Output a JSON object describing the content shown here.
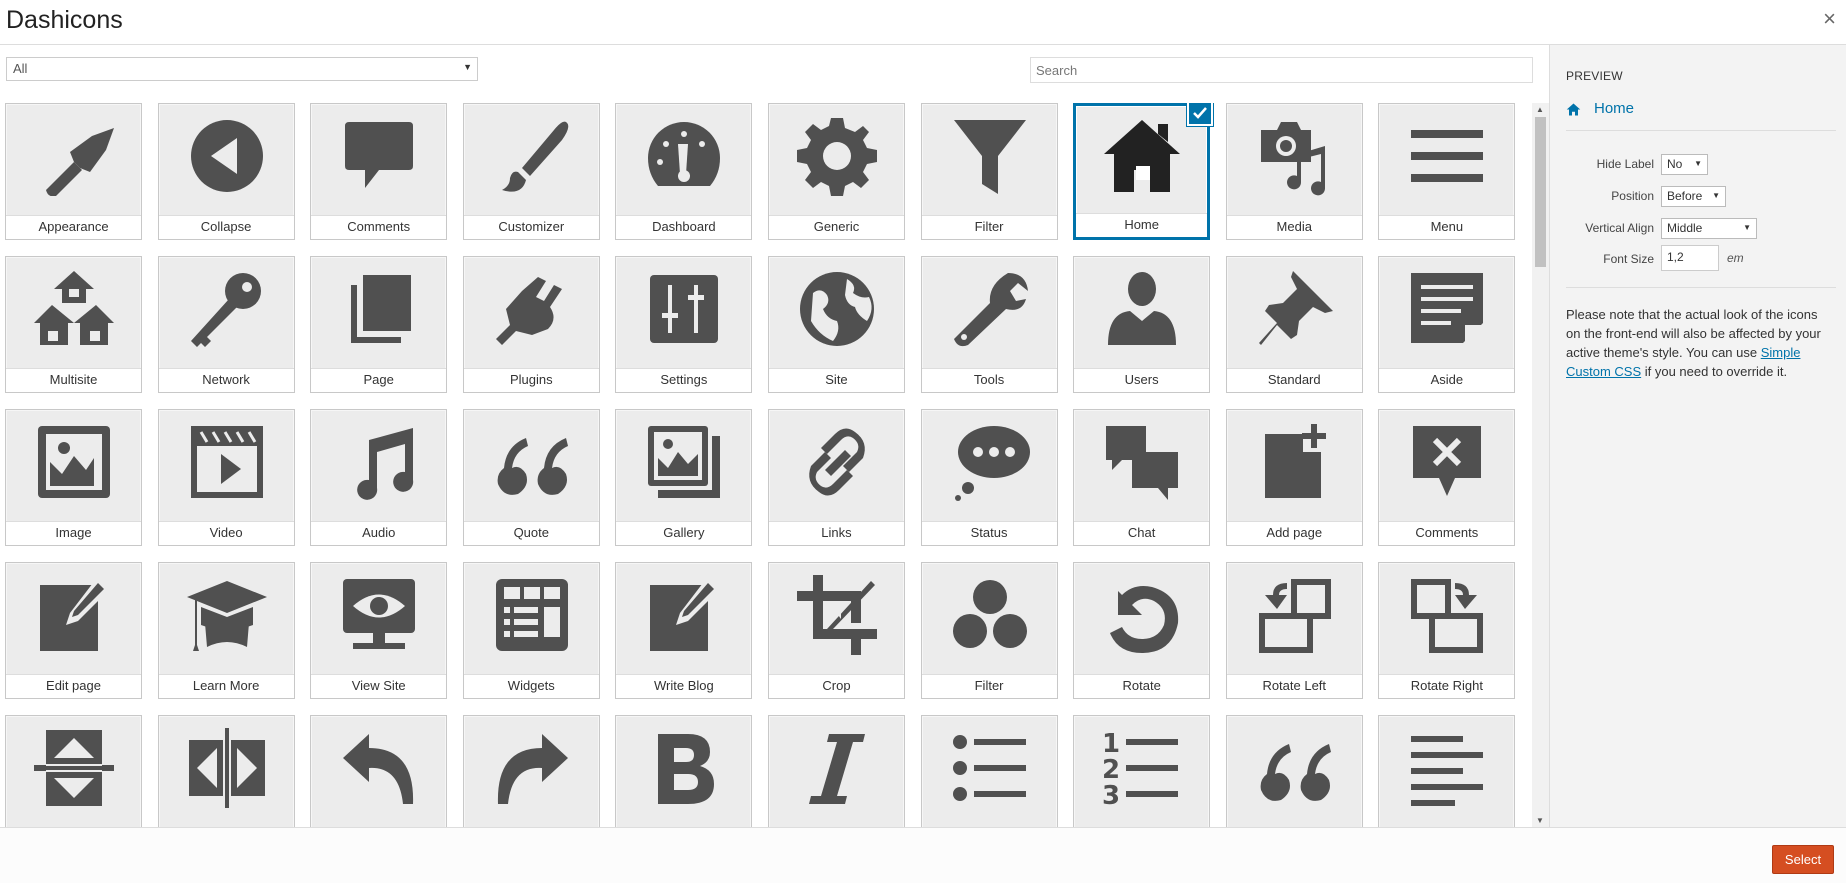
{
  "header": {
    "title": "Dashicons",
    "close_symbol": "×"
  },
  "toolbar": {
    "filter_value": "All",
    "search_placeholder": "Search"
  },
  "icon_color": "#505050",
  "accent_color": "#0073aa",
  "tiles": [
    {
      "label": "Appearance",
      "icon": "appearance-icon"
    },
    {
      "label": "Collapse",
      "icon": "collapse-icon"
    },
    {
      "label": "Comments",
      "icon": "comments-icon"
    },
    {
      "label": "Customizer",
      "icon": "customizer-icon"
    },
    {
      "label": "Dashboard",
      "icon": "dashboard-icon"
    },
    {
      "label": "Generic",
      "icon": "generic-icon"
    },
    {
      "label": "Filter",
      "icon": "filter-icon"
    },
    {
      "label": "Home",
      "icon": "home-icon",
      "selected": true
    },
    {
      "label": "Media",
      "icon": "media-icon"
    },
    {
      "label": "Menu",
      "icon": "menu-icon"
    },
    {
      "label": "Multisite",
      "icon": "multisite-icon"
    },
    {
      "label": "Network",
      "icon": "network-icon"
    },
    {
      "label": "Page",
      "icon": "page-icon"
    },
    {
      "label": "Plugins",
      "icon": "plugins-icon"
    },
    {
      "label": "Settings",
      "icon": "settings-icon"
    },
    {
      "label": "Site",
      "icon": "site-icon"
    },
    {
      "label": "Tools",
      "icon": "tools-icon"
    },
    {
      "label": "Users",
      "icon": "users-icon"
    },
    {
      "label": "Standard",
      "icon": "standard-icon"
    },
    {
      "label": "Aside",
      "icon": "aside-icon"
    },
    {
      "label": "Image",
      "icon": "image-icon"
    },
    {
      "label": "Video",
      "icon": "video-icon"
    },
    {
      "label": "Audio",
      "icon": "audio-icon"
    },
    {
      "label": "Quote",
      "icon": "quote-icon"
    },
    {
      "label": "Gallery",
      "icon": "gallery-icon"
    },
    {
      "label": "Links",
      "icon": "links-icon"
    },
    {
      "label": "Status",
      "icon": "status-icon"
    },
    {
      "label": "Chat",
      "icon": "chat-icon"
    },
    {
      "label": "Add page",
      "icon": "add-page-icon"
    },
    {
      "label": "Comments",
      "icon": "comments-x-icon"
    },
    {
      "label": "Edit page",
      "icon": "edit-page-icon"
    },
    {
      "label": "Learn More",
      "icon": "learn-more-icon"
    },
    {
      "label": "View Site",
      "icon": "view-site-icon"
    },
    {
      "label": "Widgets",
      "icon": "widgets-icon"
    },
    {
      "label": "Write Blog",
      "icon": "write-blog-icon"
    },
    {
      "label": "Crop",
      "icon": "crop-icon"
    },
    {
      "label": "Filter",
      "icon": "filter-circles-icon"
    },
    {
      "label": "Rotate",
      "icon": "rotate-icon"
    },
    {
      "label": "Rotate Left",
      "icon": "rotate-left-icon"
    },
    {
      "label": "Rotate Right",
      "icon": "rotate-right-icon"
    },
    {
      "label": "",
      "icon": "flip-vertical-icon"
    },
    {
      "label": "",
      "icon": "flip-horizontal-icon"
    },
    {
      "label": "",
      "icon": "undo-icon"
    },
    {
      "label": "",
      "icon": "redo-icon"
    },
    {
      "label": "",
      "icon": "bold-icon"
    },
    {
      "label": "",
      "icon": "italic-icon"
    },
    {
      "label": "",
      "icon": "unordered-list-icon"
    },
    {
      "label": "",
      "icon": "ordered-list-icon"
    },
    {
      "label": "",
      "icon": "quote-alt-icon"
    },
    {
      "label": "",
      "icon": "align-left-icon"
    }
  ],
  "preview": {
    "heading": "PREVIEW",
    "text": "Home",
    "options": {
      "hide_label": {
        "label": "Hide Label",
        "value": "No"
      },
      "position": {
        "label": "Position",
        "value": "Before"
      },
      "vertical_align": {
        "label": "Vertical Align",
        "value": "Middle"
      },
      "font_size": {
        "label": "Font Size",
        "value": "1,2",
        "unit": "em"
      }
    },
    "note_before": "Please note that the actual look of the icons on the front-end will also be affected by your active theme's style. You can use ",
    "note_link": "Simple Custom CSS",
    "note_after": " if you need to override it."
  },
  "footer": {
    "select_label": "Select"
  }
}
